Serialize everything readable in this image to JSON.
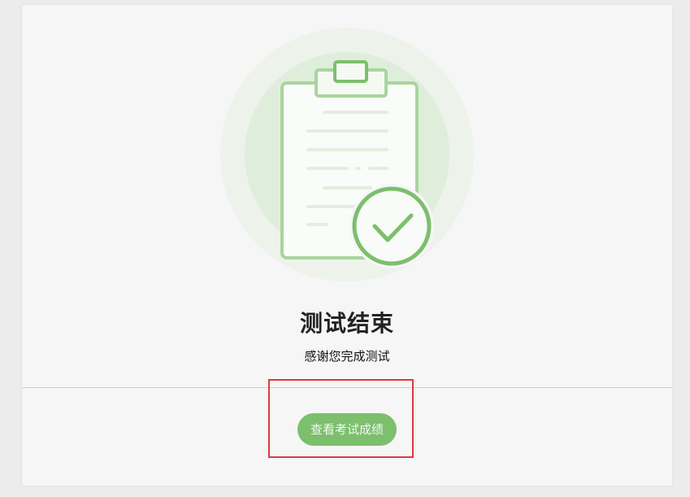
{
  "result": {
    "title": "测试结束",
    "subtitle": "感谢您完成测试"
  },
  "actions": {
    "view_score_label": "查看考试成绩"
  },
  "colors": {
    "accent": "#7cbf6d",
    "highlight": "#e0393e",
    "card_background": "#f6f6f6",
    "page_background": "#ececec"
  },
  "icons": {
    "illustration": "clipboard-check-icon"
  }
}
